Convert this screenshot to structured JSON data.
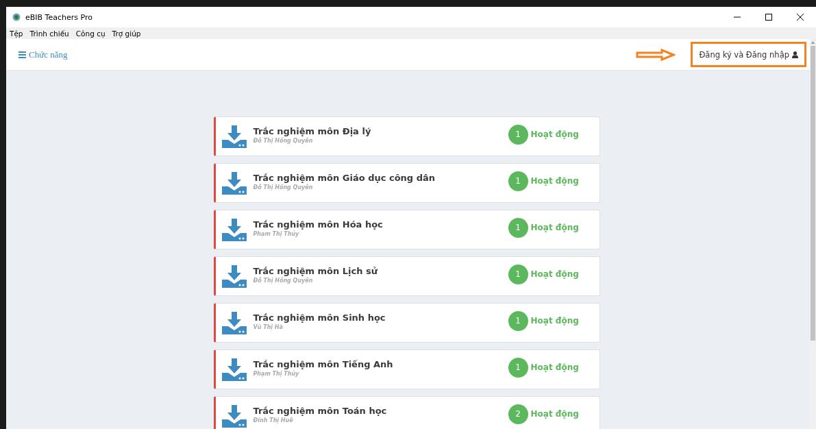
{
  "window": {
    "title": "eBIB Teachers Pro"
  },
  "menu": [
    "Tệp",
    "Trình chiếu",
    "Công cụ",
    "Trợ giúp"
  ],
  "header": {
    "menu_label": "Chức năng",
    "login_label": "Đăng ký và Đăng nhập"
  },
  "quizzes": [
    {
      "title": "Trắc nghiệm môn Địa lý",
      "author": "Đỗ Thị Hồng Quyên",
      "count": "1",
      "status": "Hoạt động"
    },
    {
      "title": "Trắc nghiệm môn Giáo dục công dân",
      "author": "Đỗ Thị Hồng Quyên",
      "count": "1",
      "status": "Hoạt động"
    },
    {
      "title": "Trắc nghiệm môn Hóa học",
      "author": "Phạm Thị Thủy",
      "count": "1",
      "status": "Hoạt động"
    },
    {
      "title": "Trắc nghiệm môn Lịch sử",
      "author": "Đỗ Thị Hồng Quyên",
      "count": "1",
      "status": "Hoạt động"
    },
    {
      "title": "Trắc nghiệm môn Sinh học",
      "author": "Vũ Thị Hà",
      "count": "1",
      "status": "Hoạt động"
    },
    {
      "title": "Trắc nghiệm môn Tiếng Anh",
      "author": "Phạm Thị Thủy",
      "count": "1",
      "status": "Hoạt động"
    },
    {
      "title": "Trắc nghiệm môn Toán học",
      "author": "Đinh Thị Huê",
      "count": "2",
      "status": "Hoạt động"
    }
  ]
}
